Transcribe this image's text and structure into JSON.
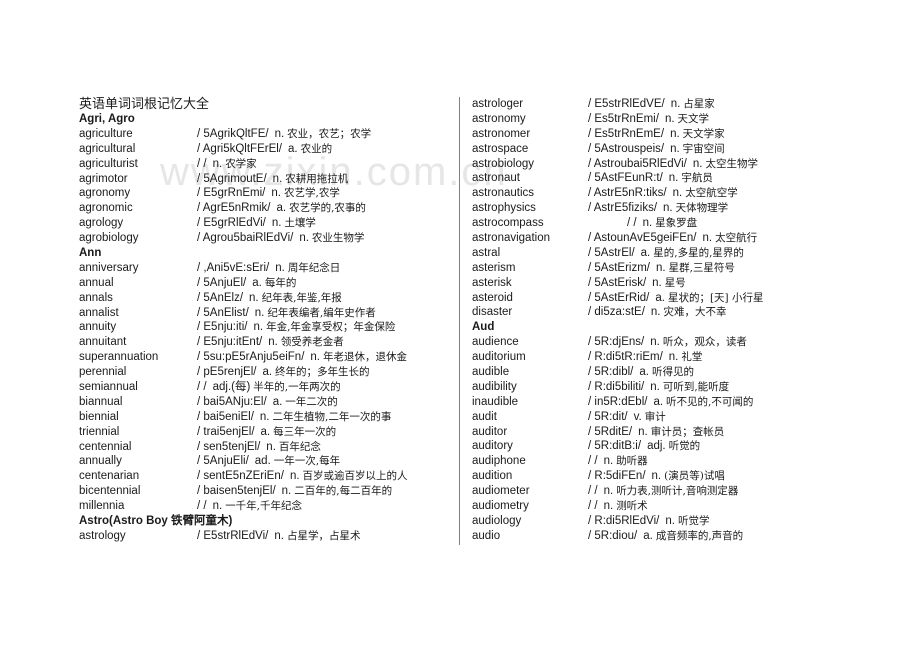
{
  "watermark": "www.zixin.com.cn",
  "title": "英语单词词根记忆大全",
  "left_column": [
    {
      "type": "section",
      "label": "Agri, Agro"
    },
    {
      "type": "entry",
      "word": "agriculture",
      "phonetic": "/ 5AgrikQltFE/",
      "pos": "n.",
      "meaning": "农业，农艺；农学"
    },
    {
      "type": "entry",
      "word": "agricultural",
      "phonetic": "/ Agri5kQltFErEl/",
      "pos": "a.",
      "meaning": "农业的"
    },
    {
      "type": "entry",
      "word": "agriculturist",
      "phonetic": "/ /",
      "pos": "n.",
      "meaning": "农学家"
    },
    {
      "type": "entry",
      "word": "agrimotor",
      "phonetic": "/ 5AgrimoutE/",
      "pos": "n.",
      "meaning": "农耕用拖拉机"
    },
    {
      "type": "entry",
      "word": "agronomy",
      "phonetic": "/ E5grRnEmi/",
      "pos": "n.",
      "meaning": "农艺学,农学"
    },
    {
      "type": "entry",
      "word": "agronomic",
      "phonetic": "/ AgrE5nRmik/",
      "pos": "a.",
      "meaning": "农艺学的,农事的"
    },
    {
      "type": "entry",
      "word": "agrology",
      "phonetic": "/ E5grRlEdVi/",
      "pos": "n.",
      "meaning": "土壤学"
    },
    {
      "type": "entry",
      "word": "agrobiology",
      "phonetic": "/ Agrou5baiRlEdVi/",
      "pos": "n.",
      "meaning": "农业生物学"
    },
    {
      "type": "section",
      "label": "Ann"
    },
    {
      "type": "entry",
      "word": "anniversary",
      "phonetic": "/ ,Ani5vE:sEri/",
      "pos": "n.",
      "meaning": "周年纪念日"
    },
    {
      "type": "entry",
      "word": "annual",
      "phonetic": "/ 5AnjuEl/",
      "pos": "a.",
      "meaning": "每年的"
    },
    {
      "type": "entry",
      "word": "annals",
      "phonetic": "/ 5AnElz/",
      "pos": "n.",
      "meaning": "纪年表,年鉴,年报"
    },
    {
      "type": "entry",
      "word": "annalist",
      "phonetic": "/ 5AnElist/",
      "pos": "n.",
      "meaning": "纪年表编者,编年史作者"
    },
    {
      "type": "entry",
      "word": "annuity",
      "phonetic": "/ E5nju:iti/",
      "pos": "n.",
      "meaning": "年金,年金享受权；年金保险"
    },
    {
      "type": "entry",
      "word": "annuitant",
      "phonetic": "/ E5nju:itEnt/",
      "pos": "n.",
      "meaning": "领受养老金者"
    },
    {
      "type": "entry",
      "word": "superannuation",
      "phonetic": "/ 5su:pE5rAnju5eiFn/",
      "pos": "n.",
      "meaning": "年老退休，退休金"
    },
    {
      "type": "entry",
      "word": "perennial",
      "phonetic": "/ pE5renjEl/",
      "pos": "a.",
      "meaning": "终年的；多年生长的"
    },
    {
      "type": "entry",
      "word": "semiannual",
      "phonetic": "/ /",
      "pos": "adj.(每)",
      "meaning": "半年的,一年两次的"
    },
    {
      "type": "entry",
      "word": "biannual",
      "phonetic": "/ bai5ANju:El/",
      "pos": "a.",
      "meaning": "一年二次的"
    },
    {
      "type": "entry",
      "word": "biennial",
      "phonetic": "/ bai5eniEl/",
      "pos": "n.",
      "meaning": "二年生植物,二年一次的事"
    },
    {
      "type": "entry",
      "word": "triennial",
      "phonetic": "/ trai5enjEl/",
      "pos": "a.",
      "meaning": "每三年一次的"
    },
    {
      "type": "entry",
      "word": "centennial",
      "phonetic": "/ sen5tenjEl/",
      "pos": "n.",
      "meaning": "百年纪念"
    },
    {
      "type": "entry",
      "word": "annually",
      "phonetic": "/ 5AnjuEli/",
      "pos": "ad.",
      "meaning": "一年一次,每年"
    },
    {
      "type": "entry",
      "word": "centenarian",
      "phonetic": "/ sentE5nZEriEn/",
      "pos": "n.",
      "meaning": "百岁或逾百岁以上的人"
    },
    {
      "type": "entry",
      "word": "bicentennial",
      "phonetic": "/ baisen5tenjEl/",
      "pos": "n.",
      "meaning": "二百年的,每二百年的"
    },
    {
      "type": "entry",
      "word": "millennia",
      "phonetic": "/ /",
      "pos": "n.",
      "meaning": "一千年,千年纪念"
    },
    {
      "type": "section",
      "label": "Astro(Astro  Boy  铁臂阿童木)"
    },
    {
      "type": "entry",
      "word": "astrology",
      "phonetic": "/ E5strRlEdVi/",
      "pos": "n.",
      "meaning": "占星学，占星术"
    }
  ],
  "right_column": [
    {
      "type": "entry",
      "word": "astrologer",
      "phonetic": "/ E5strRlEdVE/",
      "pos": "n.",
      "meaning": "占星家"
    },
    {
      "type": "entry",
      "word": "astronomy",
      "phonetic": "/ Es5trRnEmi/",
      "pos": "n.",
      "meaning": "天文学"
    },
    {
      "type": "entry",
      "word": "astronomer",
      "phonetic": "/ Es5trRnEmE/",
      "pos": "n.",
      "meaning": "天文学家"
    },
    {
      "type": "entry",
      "word": "astrospace",
      "phonetic": "/ 5Astrouspeis/",
      "pos": "n.",
      "meaning": "宇宙空间"
    },
    {
      "type": "entry",
      "word": "astrobiology",
      "phonetic": "/ Astroubai5RlEdVi/",
      "pos": "n.",
      "meaning": "太空生物学"
    },
    {
      "type": "entry",
      "word": "astronaut",
      "phonetic": "/ 5AstFEunR:t/",
      "pos": "n.",
      "meaning": "宇航员"
    },
    {
      "type": "entry",
      "word": "astronautics",
      "phonetic": "/ AstrE5nR:tiks/",
      "pos": "n.",
      "meaning": "太空航空学"
    },
    {
      "type": "entry",
      "word": "astrophysics",
      "phonetic": "/ AstrE5fiziks/",
      "pos": "n.",
      "meaning": "天体物理学"
    },
    {
      "type": "entry",
      "word": "astrocompass",
      "phonetic": "/ /",
      "pos": "n.",
      "meaning": "星象罗盘",
      "indent": true
    },
    {
      "type": "entry",
      "word": "astronavigation",
      "phonetic": "/ AstounAvE5geiFEn/",
      "pos": "n.",
      "meaning": "太空航行"
    },
    {
      "type": "entry",
      "word": "astral",
      "phonetic": "/ 5AstrEl/",
      "pos": "a.",
      "meaning": "星的,多星的,星界的"
    },
    {
      "type": "entry",
      "word": "asterism",
      "phonetic": "/ 5AstErizm/",
      "pos": "n.",
      "meaning": "星群,三星符号"
    },
    {
      "type": "entry",
      "word": "asterisk",
      "phonetic": "/ 5AstErisk/",
      "pos": "n.",
      "meaning": "星号"
    },
    {
      "type": "entry",
      "word": "asteroid",
      "phonetic": "/ 5AstErRid/",
      "pos": "a.",
      "meaning": "星状的；[天] 小行星"
    },
    {
      "type": "entry",
      "word": "disaster",
      "phonetic": "/ di5za:stE/",
      "pos": "n.",
      "meaning": "灾难，大不幸"
    },
    {
      "type": "section",
      "label": "Aud"
    },
    {
      "type": "entry",
      "word": "audience",
      "phonetic": "/ 5R:djEns/",
      "pos": "n.",
      "meaning": "听众，观众，读者"
    },
    {
      "type": "entry",
      "word": "auditorium",
      "phonetic": "/ R:di5tR:riEm/",
      "pos": "n.",
      "meaning": "礼堂"
    },
    {
      "type": "entry",
      "word": "audible",
      "phonetic": "/ 5R:dibl/",
      "pos": "a.",
      "meaning": "听得见的"
    },
    {
      "type": "entry",
      "word": "audibility",
      "phonetic": "/ R:di5biliti/",
      "pos": "n.",
      "meaning": "可听到,能听度"
    },
    {
      "type": "entry",
      "word": "inaudible",
      "phonetic": "/ in5R:dEbl/",
      "pos": "a.",
      "meaning": "听不见的,不可闻的"
    },
    {
      "type": "entry",
      "word": "audit",
      "phonetic": "/ 5R:dit/",
      "pos": "v.",
      "meaning": "审计"
    },
    {
      "type": "entry",
      "word": "auditor",
      "phonetic": "/ 5RditE/",
      "pos": "n.",
      "meaning": "审计员；查帐员"
    },
    {
      "type": "entry",
      "word": "auditory",
      "phonetic": "/ 5R:ditB:i/",
      "pos": "adj.",
      "meaning": "听觉的"
    },
    {
      "type": "entry",
      "word": "audiphone",
      "phonetic": "/ /",
      "pos": "n.",
      "meaning": "助听器"
    },
    {
      "type": "entry",
      "word": "audition",
      "phonetic": "/ R:5diFEn/",
      "pos": "n.",
      "meaning": "(演员等)试唱"
    },
    {
      "type": "entry",
      "word": "audiometer",
      "phonetic": "/ /",
      "pos": "n.",
      "meaning": "听力表,测听计,音响测定器"
    },
    {
      "type": "entry",
      "word": "audiometry",
      "phonetic": "/ /",
      "pos": "n.",
      "meaning": "测听术"
    },
    {
      "type": "entry",
      "word": "audiology",
      "phonetic": "/ R:di5RlEdVi/",
      "pos": "n.",
      "meaning": "听觉学"
    },
    {
      "type": "entry",
      "word": "audio",
      "phonetic": "/ 5R:diou/",
      "pos": "a.",
      "meaning": "成音频率的,声音的"
    }
  ]
}
